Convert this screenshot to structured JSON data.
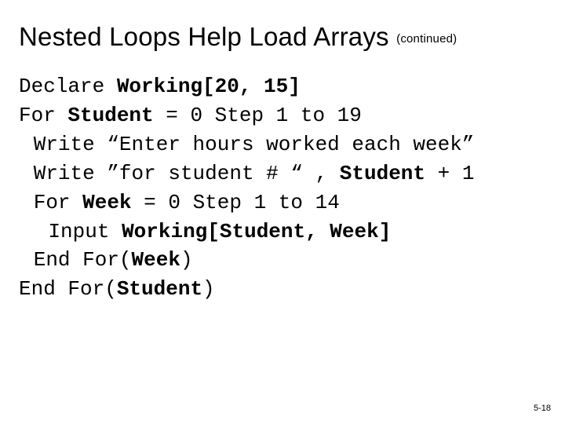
{
  "title": "Nested Loops Help Load Arrays ",
  "continued": "(continued)",
  "code": {
    "l1a": "Declare ",
    "l1b": "Working[20, 15]",
    "l2a": "For ",
    "l2b": "Student",
    "l2c": " = 0 Step 1 to 19",
    "l3a": "Write “Enter hours worked each week”",
    "l4a": "Write ”for student # “ , ",
    "l4b": "Student",
    "l4c": " + 1",
    "l5a": "For ",
    "l5b": "Week",
    "l5c": " = 0 Step 1 to 14",
    "l6a": "Input ",
    "l6b": "Working[Student, Week]",
    "l7a": "End For(",
    "l7b": "Week",
    "l7c": ")",
    "l8a": "End For(",
    "l8b": "Student",
    "l8c": ")"
  },
  "page": "5-18"
}
